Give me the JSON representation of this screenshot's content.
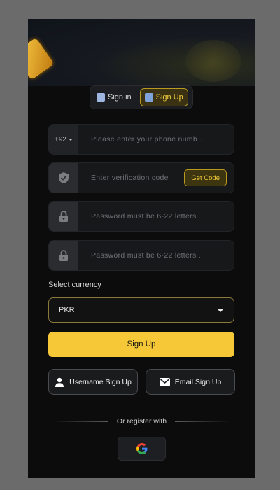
{
  "tabs": {
    "signin_label": "Sign in",
    "signup_label": "Sign Up",
    "active": "Sign Up"
  },
  "phone": {
    "prefix": "+92",
    "placeholder": "Please enter your phone numb..."
  },
  "verification": {
    "placeholder": "Enter verification code",
    "get_code_label": "Get Code"
  },
  "password": {
    "placeholder": "Password must be 6-22 letters ..."
  },
  "confirm_password": {
    "placeholder": "Password must be 6-22 letters ..."
  },
  "currency": {
    "label": "Select currency",
    "selected": "PKR"
  },
  "signup_button": "Sign Up",
  "alt_signup": {
    "username_label": "Username Sign Up",
    "email_label": "Email Sign Up"
  },
  "divider_text": "Or register with",
  "social": {
    "google_icon": "google-icon"
  },
  "colors": {
    "accent": "#f6c837",
    "background": "#0c0c0d",
    "field": "#17181a"
  }
}
